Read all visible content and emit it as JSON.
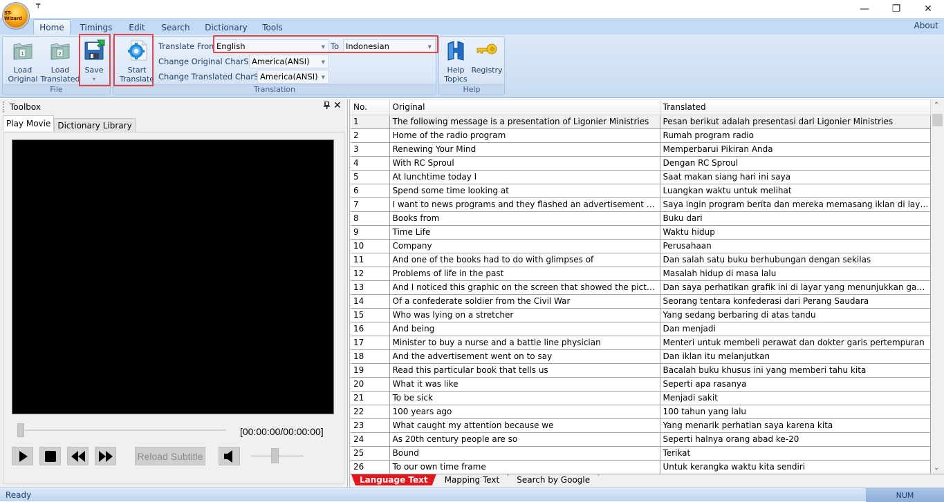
{
  "app": {
    "logo_text": "ST-Wizard",
    "qat_glyph": "₸",
    "window_controls": {
      "minimize": "—",
      "restore": "❐",
      "close": "✕"
    }
  },
  "ribbon": {
    "tabs": [
      {
        "label": "Home",
        "active": true
      },
      {
        "label": "Timings",
        "active": false
      },
      {
        "label": "Edit",
        "active": false
      },
      {
        "label": "Search",
        "active": false
      },
      {
        "label": "Dictionary",
        "active": false
      },
      {
        "label": "Tools",
        "active": false
      }
    ],
    "about_label": "About",
    "groups": {
      "file": {
        "label": "File",
        "load_original": {
          "line1": "Load",
          "line2": "Original",
          "icon": "folder-1-icon"
        },
        "load_translated": {
          "line1": "Load",
          "line2": "Translated",
          "icon": "folder-2-icon"
        },
        "save": {
          "label": "Save",
          "dropdown": "▾",
          "icon": "floppy-disk-icon"
        }
      },
      "translation": {
        "label": "Translation",
        "start_translate": {
          "line1": "Start",
          "line2": "Translate",
          "icon": "gear-document-icon"
        },
        "translate_from_label": "Translate From",
        "translate_from_value": "English",
        "to_label": "To",
        "to_value": "Indonesian",
        "original_charset_label": "Change Original CharSet",
        "original_charset_value": "America(ANSI)",
        "translated_charset_label": "Change Translated CharSet",
        "translated_charset_value": "America(ANSI)"
      },
      "help": {
        "label": "Help",
        "help_topics": {
          "line1": "Help",
          "line2": "Topics",
          "icon": "help-h-icon"
        },
        "registry": {
          "label": "Registry",
          "icon": "key-icon"
        }
      }
    },
    "highlight_color": "#e0454a"
  },
  "toolbox": {
    "title": "Toolbox",
    "pin_glyph": "📌",
    "close_glyph": "✕",
    "tabs": [
      {
        "label": "Play Movie",
        "active": true
      },
      {
        "label": "Dictionary Library",
        "active": false
      }
    ],
    "player": {
      "time_readout": "[00:00:00/00:00:00]",
      "seek_progress": 0,
      "volume_level": 0.45,
      "reload_label": "Reload Subtitle"
    }
  },
  "grid": {
    "columns": [
      "No.",
      "Original",
      "Translated"
    ],
    "rows": [
      {
        "no": "1",
        "original": "The following message is a presentation of Ligonier Ministries",
        "translated": "Pesan berikut adalah presentasi dari Ligonier Ministries"
      },
      {
        "no": "2",
        "original": "Home of the radio program",
        "translated": "Rumah program radio"
      },
      {
        "no": "3",
        "original": "Renewing Your Mind",
        "translated": "Memperbarui Pikiran Anda"
      },
      {
        "no": "4",
        "original": "With RC Sproul",
        "translated": "Dengan RC Sproul"
      },
      {
        "no": "5",
        "original": "At lunchtime today I",
        "translated": "Saat makan siang hari ini saya"
      },
      {
        "no": "6",
        "original": "Spend some time looking at",
        "translated": "Luangkan waktu untuk melihat"
      },
      {
        "no": "7",
        "original": "I want to news programs and they flashed an advertisement on the scre...",
        "translated": "Saya ingin program berita dan mereka memasang iklan di layar yang m..."
      },
      {
        "no": "8",
        "original": "Books from",
        "translated": "Buku dari"
      },
      {
        "no": "9",
        "original": "Time Life",
        "translated": "Waktu hidup"
      },
      {
        "no": "10",
        "original": "Company",
        "translated": "Perusahaan"
      },
      {
        "no": "11",
        "original": "And one of the books had to do with glimpses of",
        "translated": "Dan salah satu buku berhubungan dengan sekilas"
      },
      {
        "no": "12",
        "original": "Problems of life in the past",
        "translated": "Masalah hidup di masa lalu"
      },
      {
        "no": "13",
        "original": "And I noticed this graphic on the screen that showed the picture",
        "translated": "Dan saya perhatikan grafik ini di layar yang menunjukkan gambar itu"
      },
      {
        "no": "14",
        "original": "Of a confederate soldier from the Civil War",
        "translated": "Seorang tentara konfederasi dari Perang Saudara"
      },
      {
        "no": "15",
        "original": "Who was lying on a stretcher",
        "translated": "Yang sedang berbaring di atas tandu"
      },
      {
        "no": "16",
        "original": "And being",
        "translated": "Dan menjadi"
      },
      {
        "no": "17",
        "original": "Minister to buy a nurse and a battle line physician",
        "translated": "Menteri untuk membeli perawat dan dokter garis pertempuran"
      },
      {
        "no": "18",
        "original": "And the advertisement went on to say",
        "translated": "Dan iklan itu melanjutkan"
      },
      {
        "no": "19",
        "original": "Read this particular book that tells us",
        "translated": "Bacalah buku khusus ini yang memberi tahu kita"
      },
      {
        "no": "20",
        "original": "What it was like",
        "translated": "Seperti apa rasanya"
      },
      {
        "no": "21",
        "original": "To be sick",
        "translated": "Menjadi sakit"
      },
      {
        "no": "22",
        "original": "100 years ago",
        "translated": "100 tahun yang lalu"
      },
      {
        "no": "23",
        "original": "What caught my attention because we",
        "translated": "Yang menarik perhatian saya karena kita"
      },
      {
        "no": "24",
        "original": "As 20th century people are so",
        "translated": "Seperti halnya orang abad ke-20"
      },
      {
        "no": "25",
        "original": "Bound",
        "translated": "Terikat"
      },
      {
        "no": "26",
        "original": "To our own time frame",
        "translated": "Untuk kerangka waktu kita sendiri"
      }
    ],
    "selected_row": 0,
    "bottom_tabs": [
      {
        "label": "Language Text",
        "active": true
      },
      {
        "label": "Mapping Text",
        "active": false
      },
      {
        "label": "Search by Google",
        "active": false
      }
    ],
    "active_tab_color": "#e8141c"
  },
  "statusbar": {
    "status": "Ready",
    "num_indicator": "NUM"
  }
}
